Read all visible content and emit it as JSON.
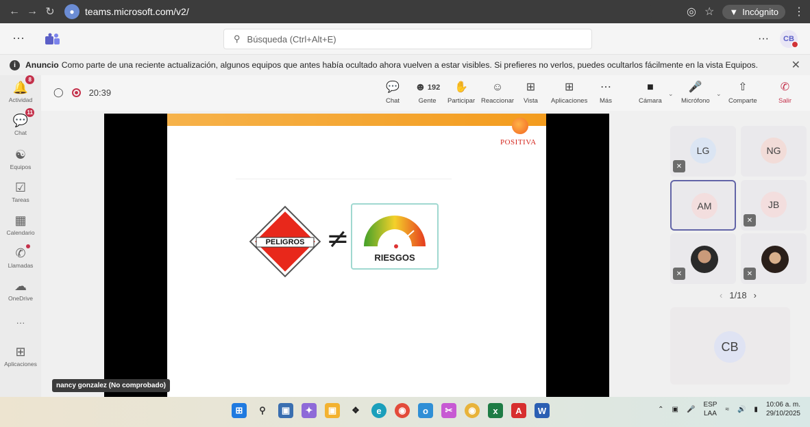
{
  "browser": {
    "url": "teams.microsoft.com/v2/",
    "incognito_label": "Incógnito"
  },
  "teams_header": {
    "search_placeholder": "Búsqueda (Ctrl+Alt+E)",
    "more": "···",
    "user_initials": "CB"
  },
  "announcement": {
    "title": "Anuncio",
    "text": "Como parte de una reciente actualización, algunos equipos que antes había ocultado ahora vuelven a estar visibles. Si prefieres no verlos, puedes ocultarlos fácilmente en la vista Equipos."
  },
  "rail": {
    "items": [
      {
        "label": "Actividad",
        "badge": "8"
      },
      {
        "label": "Chat",
        "badge": "11"
      },
      {
        "label": "Equipos"
      },
      {
        "label": "Tareas"
      },
      {
        "label": "Calendario"
      },
      {
        "label": "Llamadas"
      },
      {
        "label": "OneDrive"
      },
      {
        "label": "···"
      },
      {
        "label": "Aplicaciones"
      }
    ]
  },
  "meeting": {
    "timer": "20:39",
    "toolbar": {
      "chat": "Chat",
      "people": "Gente",
      "people_count": "192",
      "raise": "Participar",
      "react": "Reaccionar",
      "view": "Vista",
      "apps": "Aplicaciones",
      "more": "Más",
      "camera": "Cámara",
      "mic": "Micrófono",
      "share": "Comparte",
      "leave": "Salir"
    }
  },
  "slide": {
    "logo": "POSITIVA",
    "hazard_label": "PELIGROS",
    "neq": "≠",
    "risk_label": "RIESGOS"
  },
  "presenter_tag": "nancy gonzalez (No comprobado)",
  "participants": [
    {
      "initials": "LG",
      "color": "#dbe5f3"
    },
    {
      "initials": "NG",
      "color": "#f2dcd8"
    },
    {
      "initials": "AM",
      "color": "#f3dede"
    },
    {
      "initials": "JB",
      "color": "#f3dede"
    }
  ],
  "pager": "1/18",
  "self_initials": "CB",
  "taskbar": {
    "lang_top": "ESP",
    "lang_bottom": "LAA",
    "time": "10:06 a. m.",
    "date": "29/10/2025"
  }
}
